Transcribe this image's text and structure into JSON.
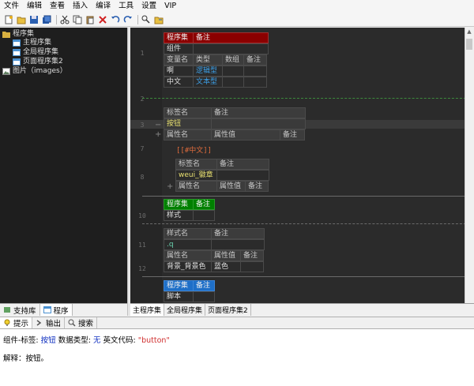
{
  "menu": [
    "文件",
    "编辑",
    "查看",
    "插入",
    "编译",
    "工具",
    "设置",
    "VIP"
  ],
  "tree": {
    "root": "程序集",
    "items": [
      "主程序集",
      "全局程序集",
      "页面程序集2"
    ],
    "images": "图片（images）"
  },
  "left_tabs": [
    "支持库",
    "程序"
  ],
  "editor": {
    "line_numbers": [
      "1",
      "2",
      "3",
      "7",
      "8",
      "10",
      "11",
      "12"
    ],
    "t1": {
      "h1": "程序集",
      "h2": "备注",
      "r1": "组件",
      "cols": [
        "变量名",
        "类型",
        "数组",
        "备注"
      ],
      "rows": [
        [
          "啊",
          "逻辑型",
          "",
          ""
        ],
        [
          "中文",
          "文本型",
          "",
          ""
        ]
      ]
    },
    "t2": {
      "cols": [
        "标签名",
        "备注"
      ],
      "name": "按钮",
      "pcols": [
        "属性名",
        "属性值",
        "备注"
      ]
    },
    "code_line": "[[#中文]]",
    "t3": {
      "cols": [
        "标签名",
        "备注"
      ],
      "name": "weui_徽章",
      "pcols": [
        "属性名",
        "属性值",
        "备注"
      ]
    },
    "t4": {
      "h1": "程序集",
      "h2": "备注",
      "r1": "样式"
    },
    "t5": {
      "cols": [
        "样式名",
        "备注"
      ],
      "name": ".q",
      "pcols": [
        "属性名",
        "属性值",
        "备注"
      ],
      "row": [
        "背景_背景色",
        "蓝色",
        ""
      ]
    },
    "t6": {
      "h1": "程序集",
      "h2": "备注",
      "r1": "脚本"
    }
  },
  "editor_tabs": [
    "主程序集",
    "全局程序集",
    "页面程序集2"
  ],
  "bottom_tabs": [
    "提示",
    "输出",
    "搜索"
  ],
  "info": {
    "line1_a": "组件-标签:",
    "line1_b": "按钮",
    "line1_c": "数据类型:",
    "line1_d": "无",
    "line1_e": "英文代码:",
    "line1_f": "\"button\"",
    "line2": "解释：按钮。"
  },
  "colors": {
    "red_header": "#8b0000",
    "green_header": "#008000",
    "blue_header": "#1e6fc8",
    "type_blue": "#3da0e8",
    "code_orange": "#e06c3c"
  }
}
